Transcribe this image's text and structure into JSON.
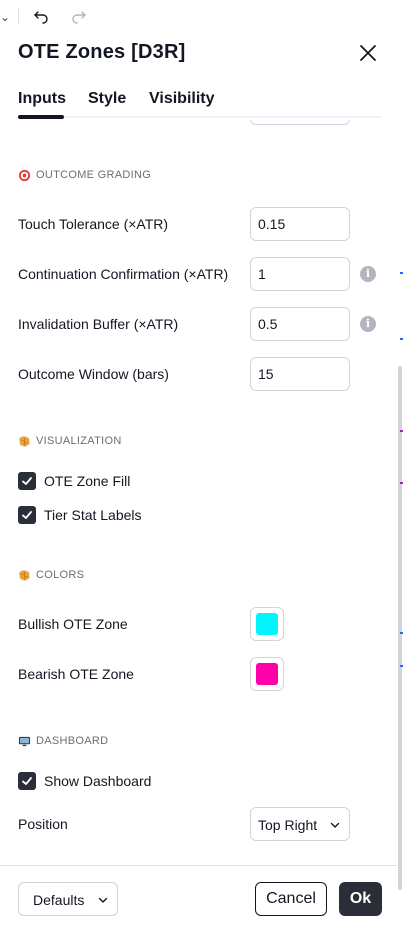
{
  "dialog": {
    "title": "OTE Zones [D3R]"
  },
  "tabs": [
    {
      "label": "Inputs",
      "active": true
    },
    {
      "label": "Style",
      "active": false
    },
    {
      "label": "Visibility",
      "active": false
    }
  ],
  "sections": {
    "outcome_grading": {
      "header": "OUTCOME GRADING",
      "icon": "target-icon",
      "fields": {
        "touch_tolerance": {
          "label": "Touch Tolerance (×ATR)",
          "value": "0.15"
        },
        "continuation": {
          "label": "Continuation Confirmation (×ATR)",
          "value": "1"
        },
        "invalidation": {
          "label": "Invalidation Buffer (×ATR)",
          "value": "0.5"
        },
        "outcome_window": {
          "label": "Outcome Window (bars)",
          "value": "15"
        }
      }
    },
    "visualization": {
      "header": "VISUALIZATION",
      "icon": "brain-icon",
      "checks": {
        "zone_fill": {
          "label": "OTE Zone Fill",
          "checked": true
        },
        "tier_labels": {
          "label": "Tier Stat Labels",
          "checked": true
        }
      }
    },
    "colors": {
      "header": "COLORS",
      "icon": "brain-icon",
      "bullish": {
        "label": "Bullish OTE Zone",
        "color": "#00f5ff"
      },
      "bearish": {
        "label": "Bearish OTE Zone",
        "color": "#ff00aa"
      }
    },
    "dashboard": {
      "header": "DASHBOARD",
      "icon": "monitor-icon",
      "show": {
        "label": "Show Dashboard",
        "checked": true
      },
      "position": {
        "label": "Position",
        "value": "Top Right"
      }
    }
  },
  "footer": {
    "defaults_label": "Defaults",
    "cancel_label": "Cancel",
    "ok_label": "Ok"
  },
  "info_glyph": "i",
  "theme": {
    "primary_dark": "#2a2e39",
    "border": "#d1d4dc",
    "muted_text": "#6a6d78"
  }
}
